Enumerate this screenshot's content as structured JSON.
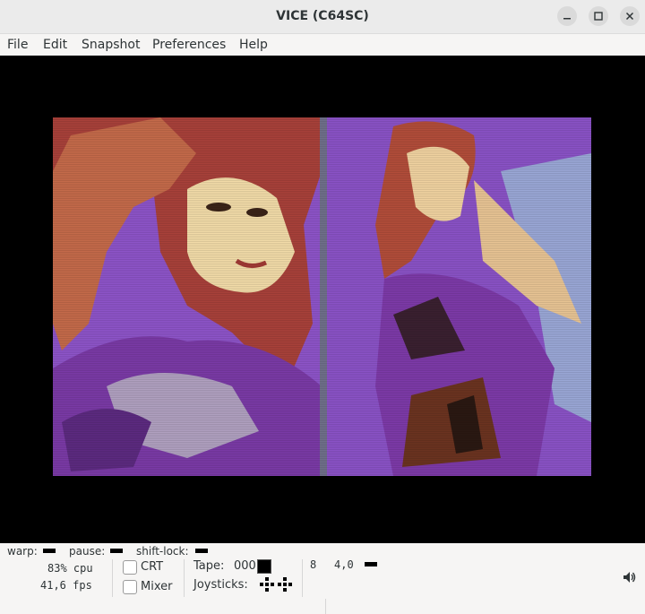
{
  "window": {
    "title": "VICE (C64SC)"
  },
  "menu": [
    "File",
    "Edit",
    "Snapshot",
    "Preferences",
    "Help"
  ],
  "screen": {
    "content": "C64 multicolor bitmap picture of two women in shiny purple outfits",
    "border_color": "#000000",
    "background_color": "#8a4fc4"
  },
  "status": {
    "warp_label": "warp:",
    "pause_label": "pause:",
    "shiftlock_label": "shift-lock:",
    "cpu": "83% cpu",
    "fps": "41,6 fps",
    "crt_label": "CRT",
    "mixer_label": "Mixer",
    "tape_label": "Tape:",
    "tape_counter": "000",
    "joysticks_label": "Joysticks:",
    "drive_number": "8",
    "drive_track": "4,0"
  }
}
